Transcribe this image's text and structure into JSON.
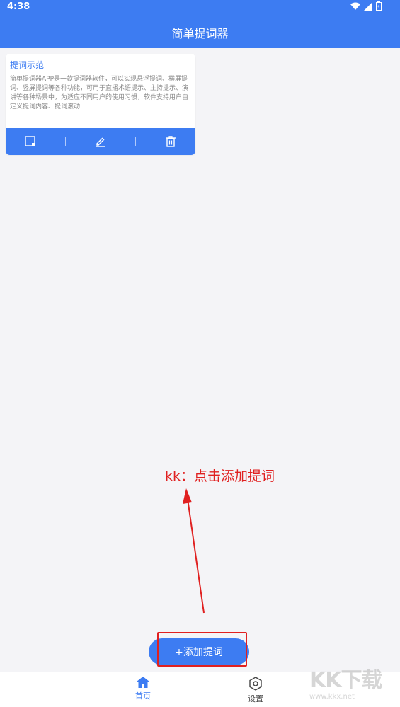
{
  "status_bar": {
    "time": "4:38"
  },
  "app_bar": {
    "title": "简单提词器"
  },
  "card": {
    "title": "提词示范",
    "body": "简单提词器APP是一款提词器软件，可以实现悬浮提词、横屏提词、竖屏提词等各种功能，可用于直播术语提示、主持提示、演讲等各种场景中，为适应不同用户的使用习惯，软件支持用户自定义提词内容、提词滚动"
  },
  "annotation": {
    "text": "kk：点击添加提词"
  },
  "add_button": {
    "label": "+添加提词"
  },
  "bottom_nav": {
    "home_label": "首页",
    "settings_label": "设置"
  },
  "watermark": {
    "logo": "KK下载",
    "url": "www.kkx.net"
  },
  "colors": {
    "primary": "#3d7cf2",
    "annotation": "#e02020",
    "background": "#f4f4f7"
  },
  "icons": [
    "wifi-icon",
    "signal-icon",
    "battery-icon",
    "float-window-icon",
    "edit-icon",
    "delete-icon",
    "home-icon",
    "settings-icon"
  ]
}
